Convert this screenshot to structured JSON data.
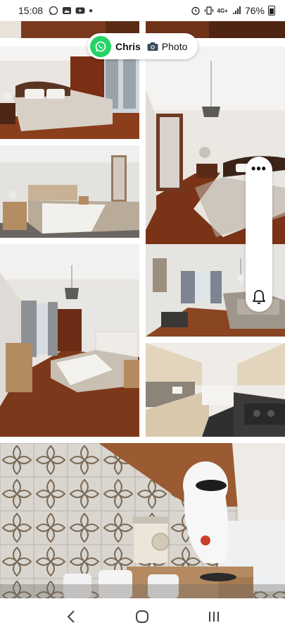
{
  "status_bar": {
    "time": "15:08",
    "left_icons": [
      "whatsapp-icon",
      "gallery-icon",
      "youtube-icon",
      "dot"
    ],
    "right_icons": [
      "alarm-icon",
      "vibrate-icon",
      "network-4g-icon",
      "signal-icon"
    ],
    "network_label": "4G+",
    "battery_percent": "76%"
  },
  "chat_pill": {
    "contact_name": "Chris",
    "icon": "camera-icon",
    "media_label": "Photo",
    "accent_color": "#25d366"
  },
  "side_panel": {
    "menu_icon": "more-options-icon",
    "bell_icon": "bell-icon"
  },
  "gallery": {
    "photos": [
      {
        "subject": "top-left-cropped-floor"
      },
      {
        "subject": "top-right-cropped-floor"
      },
      {
        "subject": "bedroom-wardrobe"
      },
      {
        "subject": "bedroom-with-lamp-and-door"
      },
      {
        "subject": "bedroom-mirror"
      },
      {
        "subject": "bedroom-wide"
      },
      {
        "subject": "living-room"
      },
      {
        "subject": "kitchen"
      },
      {
        "subject": "kitchen-closeup-tiles"
      }
    ]
  },
  "nav_bar": {
    "back": "back-icon",
    "home": "home-icon",
    "recents": "recents-icon"
  }
}
